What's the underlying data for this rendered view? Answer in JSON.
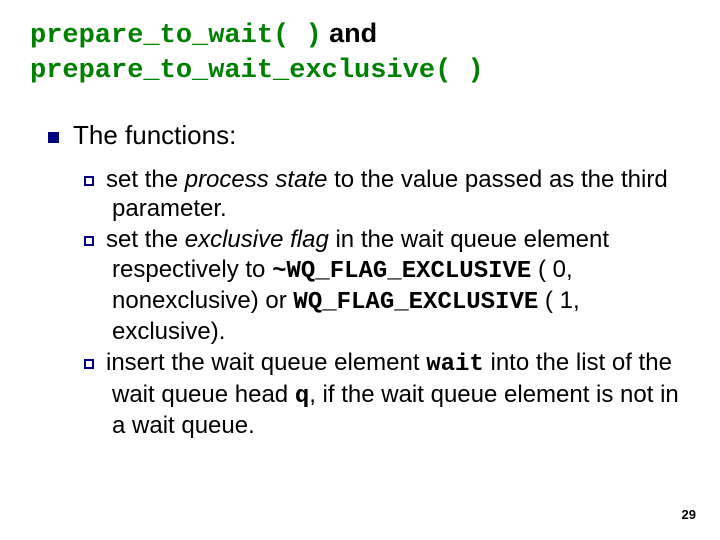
{
  "title": {
    "code1": "prepare_to_wait( )",
    "and": " and",
    "code2": "prepare_to_wait_exclusive( )"
  },
  "level1": "The functions:",
  "items": [
    {
      "pre": "set the ",
      "em": "process state",
      "post": " to the value passed as the third parameter."
    },
    {
      "a1": "set the ",
      "em": "exclusive flag",
      "a2": " in the wait queue element respectively to ",
      "c1": "~WQ_FLAG_EXCLUSIVE",
      "a3": " ( 0, nonexclusive) or ",
      "c2": "WQ_FLAG_EXCLUSIVE",
      "a4": " ( 1, exclusive)."
    },
    {
      "b1": "insert the wait queue element ",
      "c1": "wait",
      "b2": " into the list of the wait queue head ",
      "c2": "q",
      "b3": ", if the wait queue element is not in a wait queue."
    }
  ],
  "page": "29"
}
